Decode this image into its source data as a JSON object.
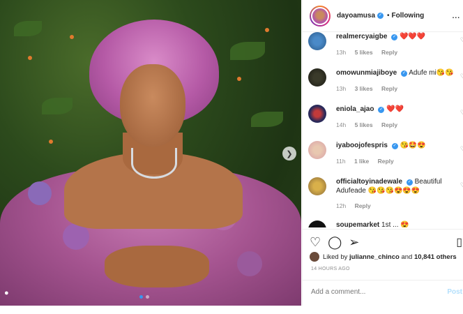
{
  "post": {
    "username": "dayoamusa",
    "separator": "•",
    "following_label": "Following",
    "more_label": "..."
  },
  "comments": [
    {
      "user": "realmercyaigbe",
      "text": "❤️❤️❤️",
      "time": "13h",
      "likes": "5 likes",
      "reply": "Reply",
      "verified": true
    },
    {
      "user": "omowunmiajiboye",
      "text": "Adufe mi😘😘",
      "time": "13h",
      "likes": "3 likes",
      "reply": "Reply",
      "verified": true
    },
    {
      "user": "eniola_ajao",
      "text": "❤️❤️",
      "time": "14h",
      "likes": "5 likes",
      "reply": "Reply",
      "verified": true
    },
    {
      "user": "iyaboojofespris",
      "text": "😘🤩😍",
      "time": "11h",
      "likes": "1 like",
      "reply": "Reply",
      "verified": true
    },
    {
      "user": "officialtoyinadewale",
      "text": "Beautiful Adufeade 😘😘😘😍😍😍",
      "time": "12h",
      "likes": "",
      "reply": "Reply",
      "verified": true
    },
    {
      "user": "soupemarket",
      "text": "1st ... 😍",
      "time": "",
      "likes": "",
      "reply": "",
      "verified": false
    }
  ],
  "likes": {
    "prefix": "Liked by",
    "user": "julianne_chinco",
    "and": "and",
    "count": "10,841 others"
  },
  "timestamp": "14 HOURS AGO",
  "composer": {
    "placeholder": "Add a comment...",
    "post_label": "Post"
  },
  "icons": [
    "heart-icon",
    "comment-icon",
    "share-icon",
    "bookmark-icon",
    "next-arrow-icon",
    "tag-person-icon"
  ],
  "colors": {
    "accent": "#3897f0",
    "post_disabled": "#b2dffc",
    "muted": "#8e8e8e"
  }
}
